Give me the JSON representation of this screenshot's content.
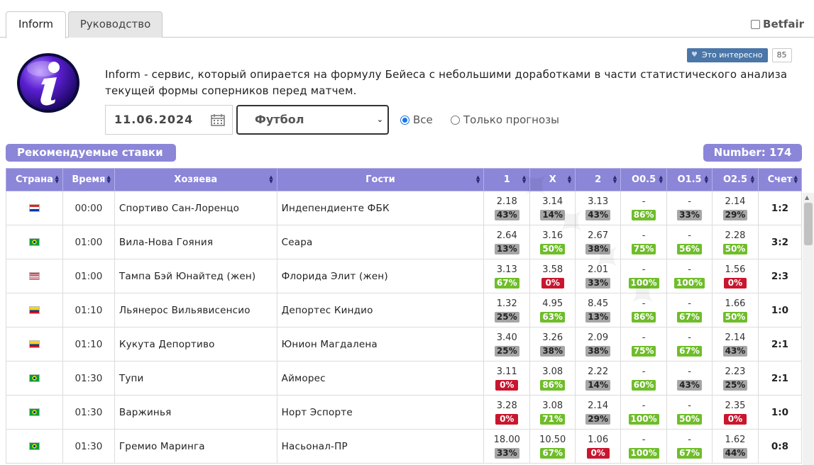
{
  "tabs": [
    {
      "label": "Inform",
      "active": true
    },
    {
      "label": "Руководство",
      "active": false
    }
  ],
  "betfair": {
    "label": "Betfair",
    "checked": false
  },
  "like": {
    "label": "Это интересно",
    "count": "85"
  },
  "description": "Inform - сервис, который опирается на формулу Бейеса с небольшими доработками в части статистического анализа текущей формы соперников перед матчем.",
  "filters": {
    "date": "11.06.2024",
    "sport": "Футбол",
    "radio_all": "Все",
    "radio_predictions": "Только прогнозы",
    "selected": "all"
  },
  "recommended_label": "Рекомендуемые ставки",
  "number_label": "Number: 174",
  "columns": [
    "Страна",
    "Время",
    "Хозяева",
    "Гости",
    "1",
    "X",
    "2",
    "O0.5",
    "O1.5",
    "O2.5",
    "Счет"
  ],
  "colors": {
    "header": "#8c86d8",
    "green": "#6fbd2a",
    "red": "#c9162f",
    "gray": "#a6a6a6"
  },
  "rows": [
    {
      "flag": "paraguay-flag",
      "time": "00:00",
      "home": "Спортиво Сан-Лоренцо",
      "away": "Индепендиенте ФБК",
      "odds": [
        {
          "v": "2.18",
          "p": "43%",
          "c": "gray"
        },
        {
          "v": "3.14",
          "p": "14%",
          "c": "gray"
        },
        {
          "v": "3.13",
          "p": "43%",
          "c": "gray"
        },
        {
          "v": "-",
          "p": "86%",
          "c": "green"
        },
        {
          "v": "-",
          "p": "33%",
          "c": "gray"
        },
        {
          "v": "2.14",
          "p": "29%",
          "c": "gray"
        }
      ],
      "score": "1:2"
    },
    {
      "flag": "brazil-flag",
      "time": "01:00",
      "home": "Вила-Нова Гояния",
      "away": "Сеара",
      "odds": [
        {
          "v": "2.64",
          "p": "13%",
          "c": "gray"
        },
        {
          "v": "3.16",
          "p": "50%",
          "c": "green"
        },
        {
          "v": "2.67",
          "p": "38%",
          "c": "gray"
        },
        {
          "v": "-",
          "p": "75%",
          "c": "green"
        },
        {
          "v": "-",
          "p": "56%",
          "c": "green"
        },
        {
          "v": "2.28",
          "p": "50%",
          "c": "green"
        }
      ],
      "score": "3:2"
    },
    {
      "flag": "usa-flag",
      "time": "01:00",
      "home": "Тампа Бэй Юнайтед (жен)",
      "away": "Флорида Элит (жен)",
      "odds": [
        {
          "v": "3.13",
          "p": "67%",
          "c": "green"
        },
        {
          "v": "3.58",
          "p": "0%",
          "c": "red"
        },
        {
          "v": "2.01",
          "p": "33%",
          "c": "gray"
        },
        {
          "v": "-",
          "p": "100%",
          "c": "green"
        },
        {
          "v": "-",
          "p": "100%",
          "c": "green"
        },
        {
          "v": "1.56",
          "p": "0%",
          "c": "red"
        }
      ],
      "score": "2:3"
    },
    {
      "flag": "colombia-flag",
      "time": "01:10",
      "home": "Льянерос Вильявисенсио",
      "away": "Депортес Киндио",
      "odds": [
        {
          "v": "1.32",
          "p": "25%",
          "c": "gray"
        },
        {
          "v": "4.95",
          "p": "63%",
          "c": "green"
        },
        {
          "v": "8.45",
          "p": "13%",
          "c": "gray"
        },
        {
          "v": "-",
          "p": "86%",
          "c": "green"
        },
        {
          "v": "-",
          "p": "67%",
          "c": "green"
        },
        {
          "v": "1.66",
          "p": "50%",
          "c": "green"
        }
      ],
      "score": "1:0"
    },
    {
      "flag": "colombia-flag",
      "time": "01:10",
      "home": "Кукута Депортиво",
      "away": "Юнион Магдалена",
      "odds": [
        {
          "v": "3.40",
          "p": "25%",
          "c": "gray"
        },
        {
          "v": "3.26",
          "p": "38%",
          "c": "gray"
        },
        {
          "v": "2.09",
          "p": "38%",
          "c": "gray"
        },
        {
          "v": "-",
          "p": "75%",
          "c": "green"
        },
        {
          "v": "-",
          "p": "67%",
          "c": "green"
        },
        {
          "v": "2.14",
          "p": "43%",
          "c": "gray"
        }
      ],
      "score": "2:1"
    },
    {
      "flag": "brazil-flag",
      "time": "01:30",
      "home": "Тупи",
      "away": "Айморес",
      "odds": [
        {
          "v": "3.11",
          "p": "0%",
          "c": "red"
        },
        {
          "v": "3.08",
          "p": "86%",
          "c": "green"
        },
        {
          "v": "2.22",
          "p": "14%",
          "c": "gray"
        },
        {
          "v": "-",
          "p": "60%",
          "c": "green"
        },
        {
          "v": "-",
          "p": "43%",
          "c": "gray"
        },
        {
          "v": "2.23",
          "p": "25%",
          "c": "gray"
        }
      ],
      "score": "2:1"
    },
    {
      "flag": "brazil-flag",
      "time": "01:30",
      "home": "Варжинья",
      "away": "Норт Эспорте",
      "odds": [
        {
          "v": "3.28",
          "p": "0%",
          "c": "red"
        },
        {
          "v": "3.08",
          "p": "71%",
          "c": "green"
        },
        {
          "v": "2.14",
          "p": "29%",
          "c": "gray"
        },
        {
          "v": "-",
          "p": "100%",
          "c": "green"
        },
        {
          "v": "-",
          "p": "50%",
          "c": "green"
        },
        {
          "v": "2.35",
          "p": "0%",
          "c": "red"
        }
      ],
      "score": "1:0"
    },
    {
      "flag": "brazil-flag",
      "time": "01:30",
      "home": "Гремио Маринга",
      "away": "Насьонал-ПР",
      "odds": [
        {
          "v": "18.00",
          "p": "33%",
          "c": "gray"
        },
        {
          "v": "10.50",
          "p": "67%",
          "c": "green"
        },
        {
          "v": "1.06",
          "p": "0%",
          "c": "red"
        },
        {
          "v": "-",
          "p": "100%",
          "c": "green"
        },
        {
          "v": "-",
          "p": "67%",
          "c": "green"
        },
        {
          "v": "1.62",
          "p": "44%",
          "c": "gray"
        }
      ],
      "score": "0:8"
    }
  ]
}
